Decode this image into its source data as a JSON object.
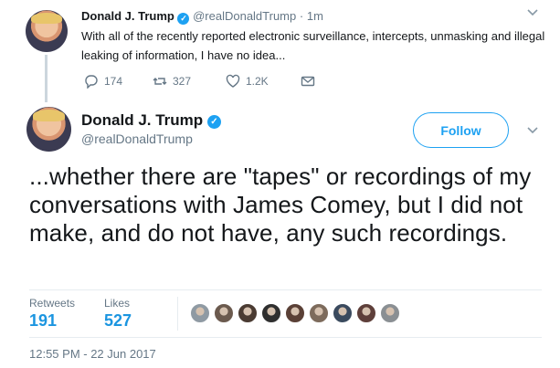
{
  "reply_tweet": {
    "name": "Donald J. Trump",
    "handle": "@realDonaldTrump",
    "dot": "·",
    "time": "1m",
    "text": "With all of the recently reported electronic surveillance, intercepts, unmasking and illegal leaking of information, I have no idea...",
    "actions": {
      "replies": "174",
      "retweets": "327",
      "likes": "1.2K"
    }
  },
  "main_tweet": {
    "name": "Donald J. Trump",
    "handle": "@realDonaldTrump",
    "follow_label": "Follow",
    "text": "...whether there are \"tapes\" or recordings of my conversations with James Comey, but I did not make, and do not have, any such recordings.",
    "stats": {
      "retweets_label": "Retweets",
      "retweets_value": "191",
      "likes_label": "Likes",
      "likes_value": "527"
    },
    "timestamp": "12:55 PM - 22 Jun 2017"
  },
  "likers": [
    {
      "name": "liker-1",
      "color": "#8f9aa3"
    },
    {
      "name": "liker-2",
      "color": "#6b5a4e"
    },
    {
      "name": "liker-3",
      "color": "#4a3b32"
    },
    {
      "name": "liker-4",
      "color": "#2f2f2f"
    },
    {
      "name": "liker-5",
      "color": "#5a4036"
    },
    {
      "name": "liker-6",
      "color": "#7d6b5c"
    },
    {
      "name": "liker-7",
      "color": "#3a4a5e"
    },
    {
      "name": "liker-8",
      "color": "#5e3f3a"
    },
    {
      "name": "liker-9",
      "color": "#8a8f93"
    }
  ],
  "colors": {
    "brand_blue": "#1da1f2",
    "link_blue": "#1b95e0",
    "muted": "#657786",
    "text": "#14171a"
  }
}
